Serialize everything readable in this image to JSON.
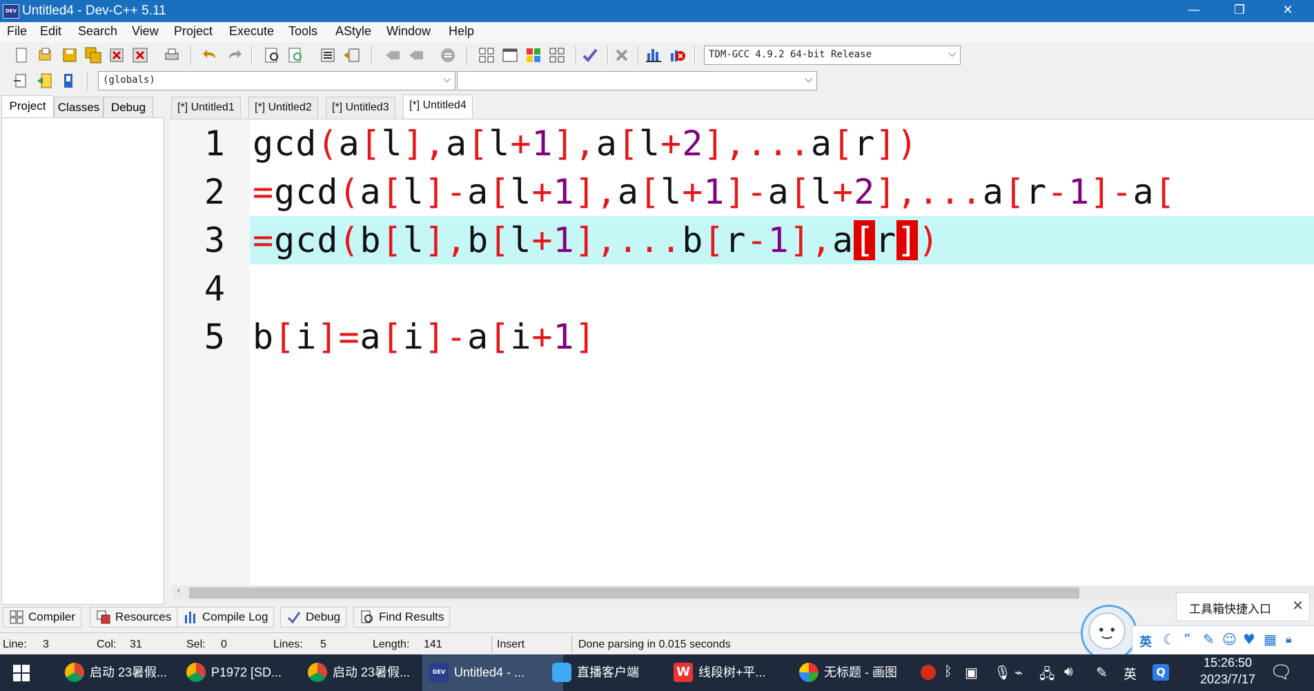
{
  "window": {
    "title": "Untitled4 - Dev-C++ 5.11",
    "app_icon_text": "DEV",
    "minimize": "—",
    "restore": "❐",
    "close": "✕"
  },
  "menu": [
    "File",
    "Edit",
    "Search",
    "View",
    "Project",
    "Execute",
    "Tools",
    "AStyle",
    "Window",
    "Help"
  ],
  "toolbar": {
    "compiler_select": "TDM-GCC 4.9.2 64-bit Release",
    "scope_select": "(globals)",
    "symbol_select": ""
  },
  "left_panel": {
    "tabs": [
      "Project",
      "Classes",
      "Debug"
    ],
    "active_tab": "Project"
  },
  "editor_tabs": [
    "[*] Untitled1",
    "[*] Untitled2",
    "[*] Untitled3",
    "[*] Untitled4"
  ],
  "active_editor_tab": "[*] Untitled4",
  "code_lines": [
    {
      "num": "1",
      "text": "gcd(a[l],a[l+1],a[l+2],...a[r])"
    },
    {
      "num": "2",
      "text": "=gcd(a[l]-a[l+1],a[l+1]-a[l+2],...a[r-1]-a["
    },
    {
      "num": "3",
      "text": "=gcd(b[l],b[l+1],...b[r-1],a[r])"
    },
    {
      "num": "4",
      "text": ""
    },
    {
      "num": "5",
      "text": "b[i]=a[i]-a[i+1]"
    }
  ],
  "bottom_tabs": [
    "Compiler",
    "Resources",
    "Compile Log",
    "Debug",
    "Find Results"
  ],
  "status": {
    "line_label": "Line:",
    "line": "3",
    "col_label": "Col:",
    "col": "31",
    "sel_label": "Sel:",
    "sel": "0",
    "lines_label": "Lines:",
    "lines": "5",
    "length_label": "Length:",
    "length": "141",
    "mode": "Insert",
    "message": "Done parsing in 0.015 seconds"
  },
  "taskbar": {
    "items": [
      {
        "label": "启动 23暑假...",
        "icon": "chrome-icon"
      },
      {
        "label": "P1972 [SD...",
        "icon": "chrome-icon"
      },
      {
        "label": "启动 23暑假...",
        "icon": "chrome-icon"
      },
      {
        "label": "Untitled4 - ...",
        "icon": "devcpp-icon"
      },
      {
        "label": "直播客户端",
        "icon": "cloud-icon"
      },
      {
        "label": "线段树+平...",
        "icon": "wps-icon"
      },
      {
        "label": "无标题 - 画图",
        "icon": "paint-icon"
      }
    ],
    "tray_lang": "英",
    "time": "15:26:50",
    "date": "2023/7/17"
  },
  "assistant": {
    "toolbox_label": "工具箱快捷入口",
    "ime_lang": "英"
  },
  "colors": {
    "title_bar": "#1a6fbf",
    "current_line": "#c6f7f7",
    "operator": "#e4171a",
    "number": "#800080",
    "bracket_match": "#e00000",
    "taskbar": "#1e2a3c"
  }
}
